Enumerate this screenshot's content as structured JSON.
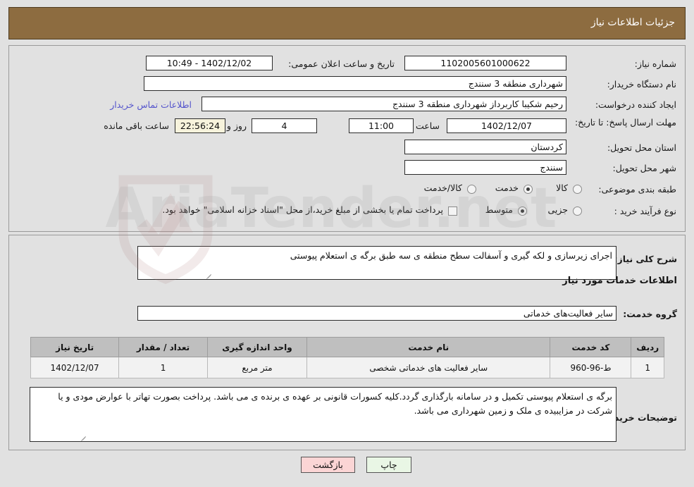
{
  "header": {
    "title": "جزئیات اطلاعات نیاز"
  },
  "form": {
    "need_number": {
      "label": "شماره نیاز:",
      "value": "1102005601000622"
    },
    "announce_datetime": {
      "label": "تاریخ و ساعت اعلان عمومی:",
      "value": "1402/12/02 - 10:49"
    },
    "buyer_org": {
      "label": "نام دستگاه خریدار:",
      "value": "شهرداری منطقه 3 سنندج"
    },
    "creator": {
      "label": "ایجاد کننده درخواست:",
      "value": "رحیم شکیبا کاربرداز شهرداری منطقه 3 سنندج"
    },
    "buyer_contact_link": "اطلاعات تماس خریدار",
    "deadline": {
      "label": "مهلت ارسال پاسخ: تا تاریخ:",
      "date": "1402/12/07",
      "time_label": "ساعت",
      "time": "11:00",
      "days": "4",
      "days_label": "روز و",
      "countdown": "22:56:24",
      "countdown_label": "ساعت باقی مانده"
    },
    "delivery_province": {
      "label": "استان محل تحویل:",
      "value": "کردستان"
    },
    "delivery_city": {
      "label": "شهر محل تحویل:",
      "value": "سنندج"
    },
    "category": {
      "label": "طبقه بندی موضوعی:",
      "options": [
        "کالا",
        "خدمت",
        "کالا/خدمت"
      ],
      "selected": "خدمت"
    },
    "purchase_process": {
      "label": "نوع فرآیند خرید :",
      "options": [
        "جزیی",
        "متوسط"
      ],
      "selected": "متوسط"
    },
    "treasury_checkbox": {
      "label": "پرداخت تمام یا بخشی از مبلغ خرید،از محل \"اسناد خزانه اسلامی\" خواهد بود.",
      "checked": false
    }
  },
  "details": {
    "general_description": {
      "label": "شرح کلی نیاز:",
      "value": "اجرای زیرسازی و لکه گیری و آسفالت سطح منطقه ی سه طبق برگه ی استعلام پیوستی"
    },
    "services_heading": "اطلاعات خدمات مورد نیاز",
    "service_group": {
      "label": "گروه خدمت:",
      "value": "سایر فعالیت‌های خدماتی"
    },
    "table": {
      "columns": [
        "ردیف",
        "کد خدمت",
        "نام خدمت",
        "واحد اندازه گیری",
        "تعداد / مقدار",
        "تاریخ نیاز"
      ],
      "rows": [
        {
          "row": "1",
          "service_code": "ط-96-960",
          "service_name": "سایر فعالیت های خدماتی شخصی",
          "unit": "متر مربع",
          "quantity": "1",
          "need_date": "1402/12/07"
        }
      ]
    },
    "buyer_notes": {
      "label": "توضیحات خریدار:",
      "value": "برگه ی استعلام پیوستی تکمیل و در سامانه بارگذاری گردد.کلیه کسورات قانونی بر عهده ی برنده ی می باشد. پرداخت بصورت تهاتر با عوارض مودی و یا شرکت در مزایبیده ی ملک و زمین شهرداری می باشد."
    }
  },
  "footer": {
    "print_button": "چاپ",
    "back_button": "بازگشت"
  },
  "watermark": {
    "text": "AriaTender.net"
  },
  "colors": {
    "header_brown": "#8d6c40",
    "page_bg": "#e1e1e1",
    "link_blue": "#5555cc",
    "countdown_bg": "#f7f3dc",
    "table_header_bg": "#bfbfbf",
    "print_btn_bg": "#e9f6e5",
    "back_btn_bg": "#fbd5d5"
  }
}
